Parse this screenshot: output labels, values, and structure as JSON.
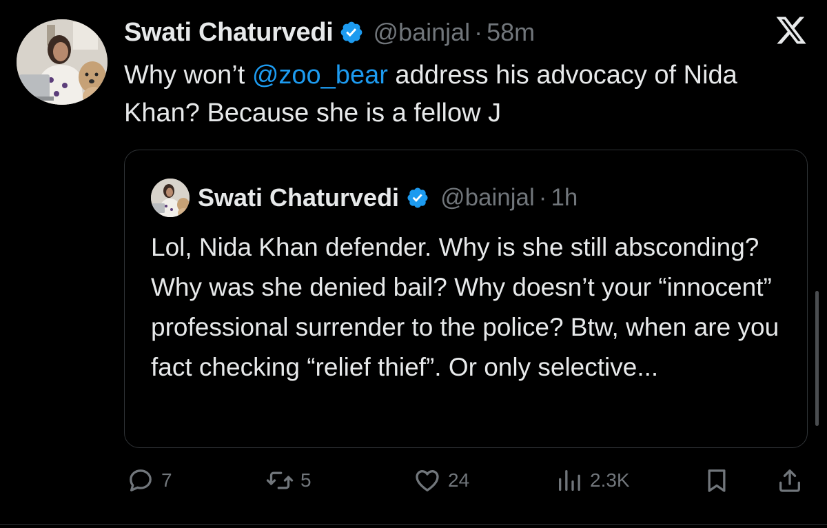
{
  "tweet": {
    "author": {
      "display_name": "Swati Chaturvedi",
      "handle": "@bainjal",
      "verified": true
    },
    "separator": "·",
    "time": "58m",
    "text_before": "Why won’t ",
    "mention": "@zoo_bear",
    "text_after": " address his advocacy of Nida Khan? Because she is a fellow J"
  },
  "quoted_tweet": {
    "author": {
      "display_name": "Swati Chaturvedi",
      "handle": "@bainjal",
      "verified": true
    },
    "separator": "·",
    "time": "1h",
    "text": "Lol, Nida Khan defender. Why is she still absconding? Why was she denied bail? Why doesn’t your “innocent” professional surrender to the police? Btw, when are you fact checking “relief thief”. Or only selective..."
  },
  "actions": {
    "replies": "7",
    "reposts": "5",
    "likes": "24",
    "views": "2.3K"
  },
  "icons": {
    "brand": "x-logo-icon",
    "verified": "verified-badge-icon",
    "reply": "reply-icon",
    "repost": "repost-icon",
    "like": "heart-icon",
    "views": "views-icon",
    "bookmark": "bookmark-icon",
    "share": "share-icon"
  },
  "colors": {
    "background": "#000000",
    "text": "#e7e9ea",
    "secondary": "#71767b",
    "accent": "#1d9bf0",
    "border": "#2f3336"
  }
}
